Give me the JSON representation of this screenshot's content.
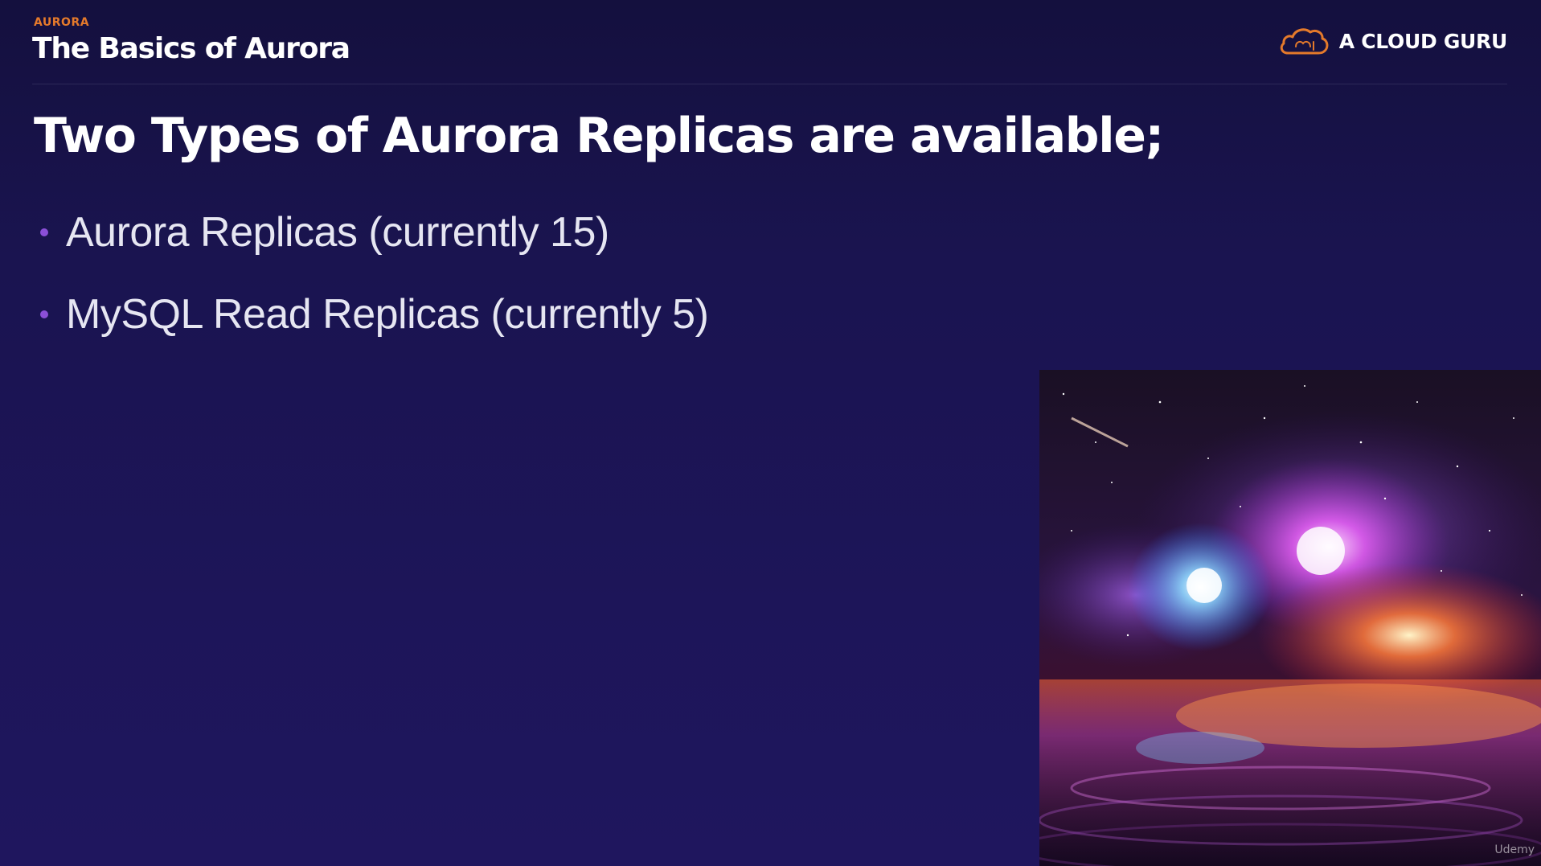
{
  "header": {
    "section_label": "AURORA",
    "deck_title": "The Basics of Aurora",
    "brand_name": "A CLOUD GURU",
    "brand_icon": "cloud-logo-icon"
  },
  "slide": {
    "headline": "Two Types of Aurora Replicas are available;",
    "bullets": [
      {
        "text": "Aurora Replicas (currently 15)"
      },
      {
        "text": "MySQL Read Replicas (currently 5)"
      }
    ]
  },
  "image": {
    "subject": "nebula",
    "watermark": "Udemy"
  },
  "colors": {
    "accent": "#e57a2b",
    "bullet": "#8b4fd8",
    "background_top": "#14103e",
    "background_bottom": "#1f165e"
  }
}
